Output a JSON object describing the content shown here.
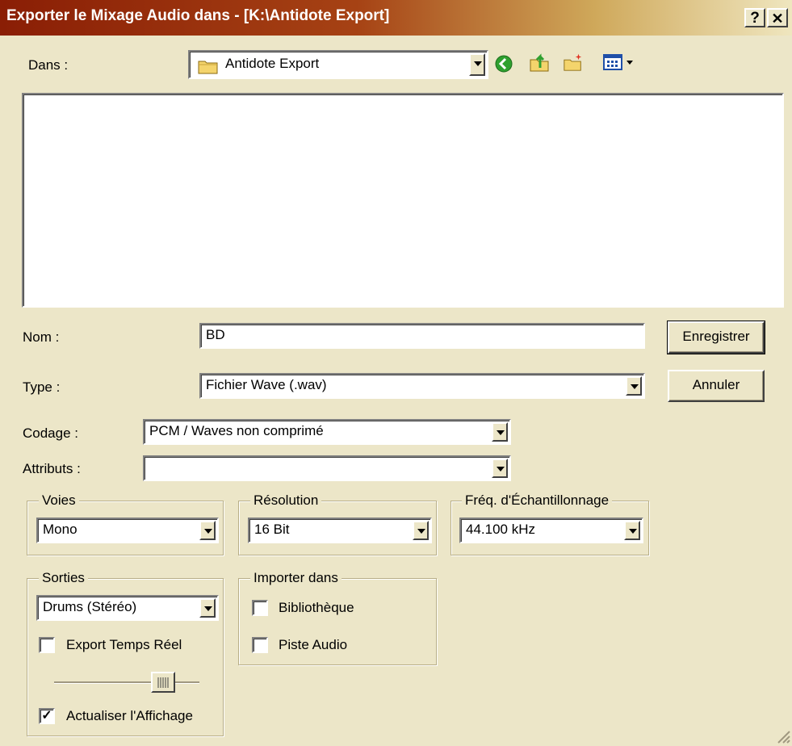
{
  "window": {
    "title": "Exporter le Mixage Audio dans - [K:\\Antidote Export]",
    "help_label": "?",
    "close_label": "✕"
  },
  "location": {
    "label": "Dans :",
    "value": "Antidote Export",
    "toolbar_icons": [
      "back-icon",
      "up-folder-icon",
      "new-folder-icon",
      "view-menu-icon"
    ]
  },
  "file_list": {
    "items": []
  },
  "name": {
    "label": "Nom :",
    "value": "BD"
  },
  "type": {
    "label": "Type :",
    "value": "Fichier Wave (.wav)"
  },
  "buttons": {
    "save": "Enregistrer",
    "cancel": "Annuler"
  },
  "encoding": {
    "label": "Codage :",
    "value": "PCM / Waves non comprimé"
  },
  "attributes": {
    "label": "Attributs :",
    "value": ""
  },
  "channels": {
    "legend": "Voies",
    "value": "Mono"
  },
  "resolution": {
    "legend": "Résolution",
    "value": "16 Bit"
  },
  "sample_rate": {
    "legend": "Fréq. d'Échantillonnage",
    "value": "44.100 kHz"
  },
  "outputs": {
    "legend": "Sorties",
    "value": "Drums (Stéréo)",
    "realtime_export": {
      "label": "Export Temps Réel",
      "checked": false
    },
    "slider_level": 0.8,
    "refresh_display": {
      "label": "Actualiser l'Affichage",
      "checked": true
    }
  },
  "import_into": {
    "legend": "Importer dans",
    "library": {
      "label": "Bibliothèque",
      "checked": false
    },
    "audio_track": {
      "label": "Piste Audio",
      "checked": false
    }
  },
  "colors": {
    "dialog_bg": "#ece6c8",
    "title_start": "#8a1e05",
    "title_end": "#efe6bf"
  }
}
